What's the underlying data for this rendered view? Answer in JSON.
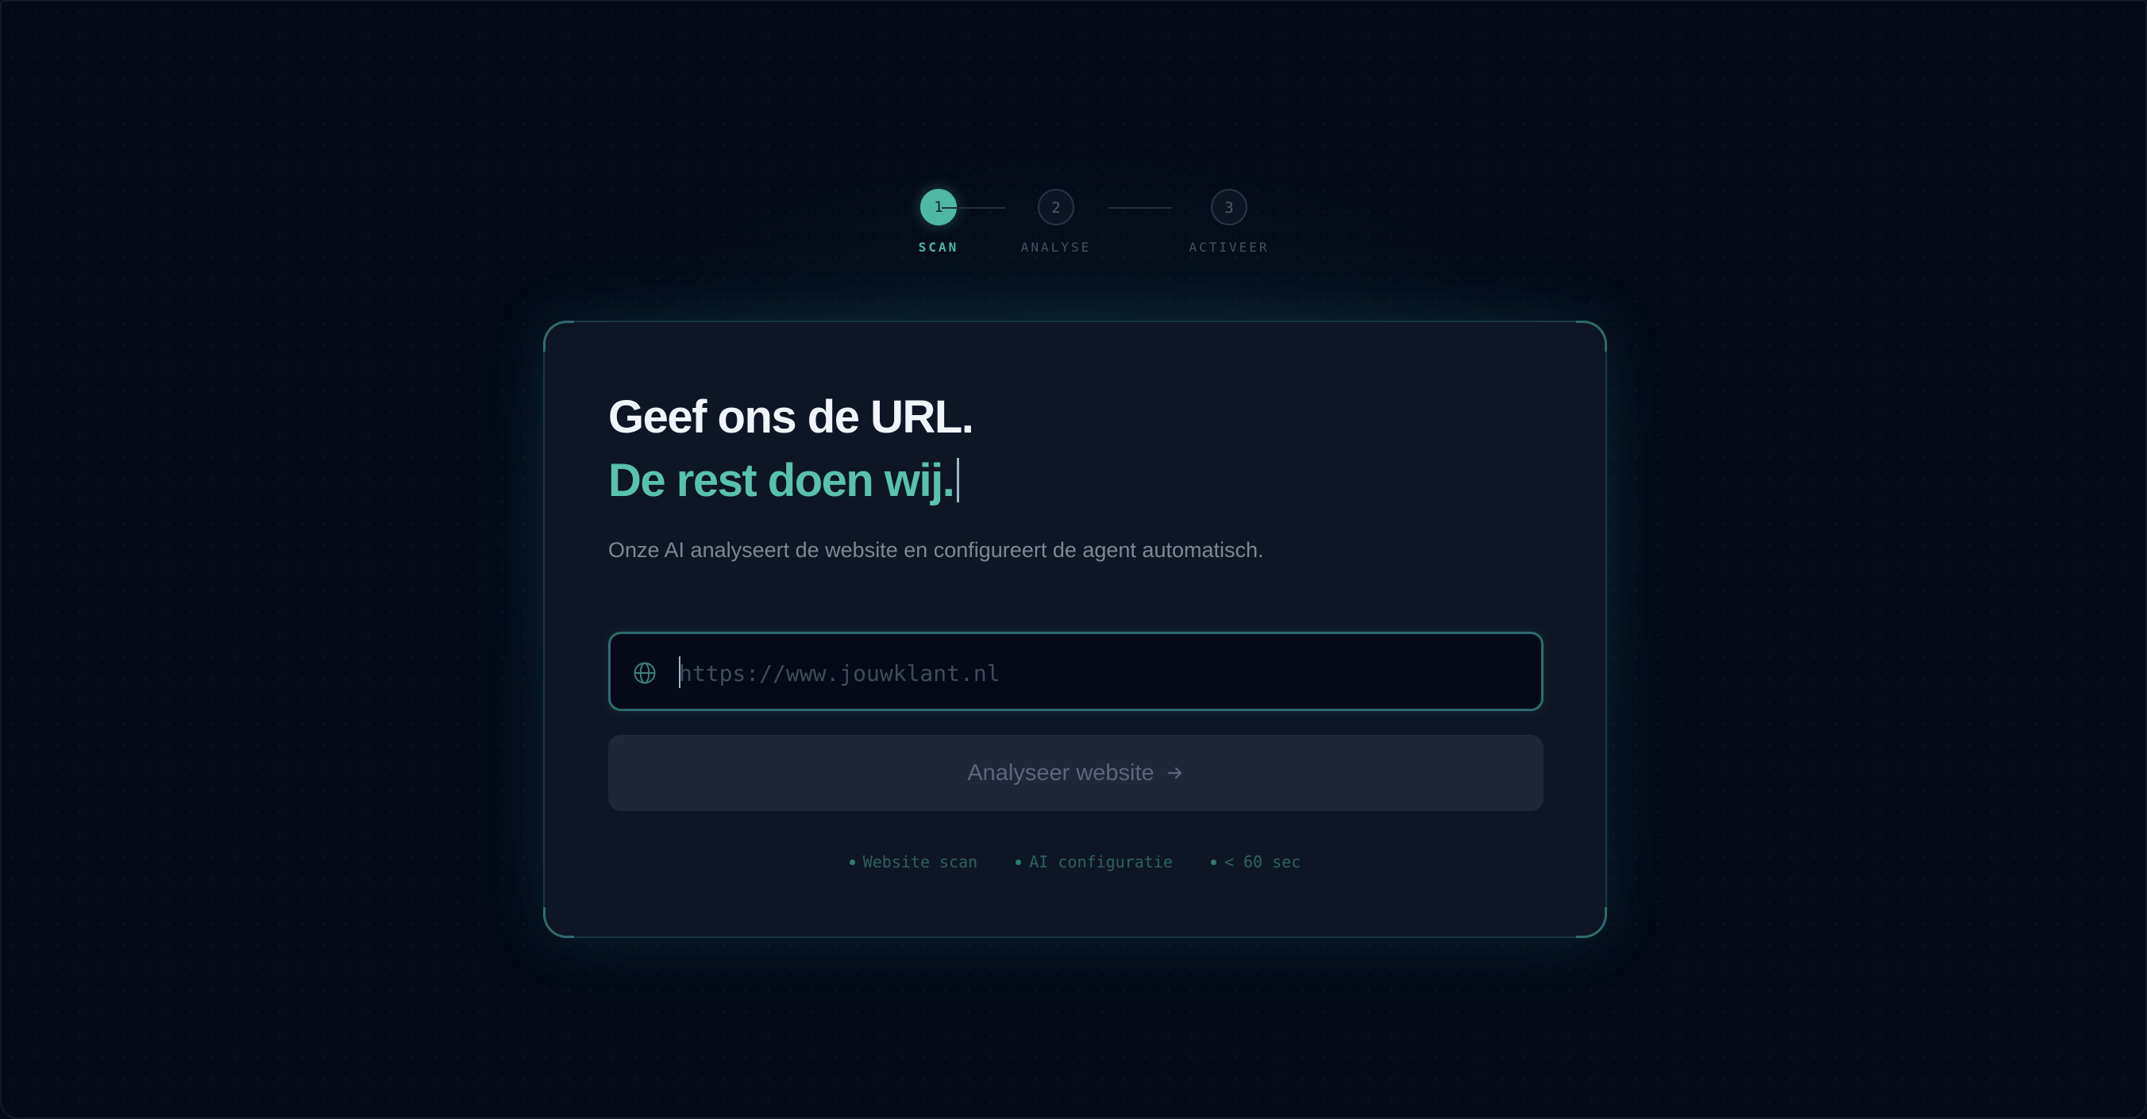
{
  "stepper": {
    "steps": [
      {
        "number": "1",
        "label": "SCAN",
        "state": "active"
      },
      {
        "number": "2",
        "label": "ANALYSE",
        "state": "upcoming"
      },
      {
        "number": "3",
        "label": "ACTIVEER",
        "state": "upcoming"
      }
    ]
  },
  "card": {
    "title": "Geef ons de URL.",
    "title_accent": "De rest doen wij.",
    "subtitle": "Onze AI analyseert de website en configureert de agent automatisch.",
    "url_input": {
      "value": "",
      "placeholder": "https://www.jouwklant.nl",
      "icon": "globe-icon"
    },
    "analyze_button": {
      "label": "Analyseer website",
      "icon": "arrow-right-icon",
      "state": "disabled"
    },
    "features": [
      "Website scan",
      "AI configuratie",
      "< 60 sec"
    ]
  },
  "colors": {
    "accent": "#59c2ac",
    "background": "#040a17",
    "card": "#0e1626"
  }
}
